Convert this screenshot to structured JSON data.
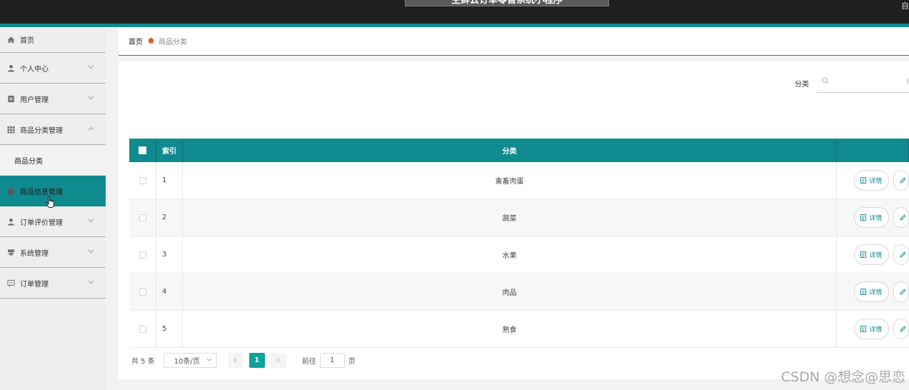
{
  "header": {
    "title": "生鲜云订单零售系统小程序",
    "corner_text": "自"
  },
  "sidebar": {
    "items": [
      {
        "label": "首页",
        "icon": "home-icon",
        "has_chevron": false
      },
      {
        "label": "个人中心",
        "icon": "user-icon",
        "has_chevron": true
      },
      {
        "label": "用户管理",
        "icon": "id-card-icon",
        "has_chevron": true
      },
      {
        "label": "商品分类管理",
        "icon": "grid-icon",
        "has_chevron": true,
        "expanded": true,
        "children": [
          {
            "label": "商品分类"
          }
        ]
      },
      {
        "label": "商品信息管理",
        "icon": "bag-icon",
        "has_chevron": false,
        "active": true
      },
      {
        "label": "订单评价管理",
        "icon": "user-icon",
        "has_chevron": true
      },
      {
        "label": "系统管理",
        "icon": "signpost-icon",
        "has_chevron": true
      },
      {
        "label": "订单管理",
        "icon": "message-icon",
        "has_chevron": true
      }
    ]
  },
  "breadcrumb": {
    "home": "首页",
    "current": "商品分类"
  },
  "search": {
    "label": "分类",
    "value": ""
  },
  "table": {
    "columns": [
      "索引",
      "分类",
      ""
    ],
    "rows": [
      {
        "index": "1",
        "category": "禽畜肉蛋"
      },
      {
        "index": "2",
        "category": "蔬菜"
      },
      {
        "index": "3",
        "category": "水果"
      },
      {
        "index": "4",
        "category": "肉品"
      },
      {
        "index": "5",
        "category": "熟食"
      }
    ],
    "detail_label": "详情"
  },
  "pagination": {
    "total": "共 5 条",
    "page_size": "10条/页",
    "current_page": "1",
    "goto_prefix": "前往",
    "goto_value": "1",
    "goto_suffix": "页"
  },
  "watermark": "CSDN @想念@思恋",
  "colors": {
    "primary": "#0f8a8f",
    "page_active": "#0fa39b",
    "breadcrumb_sep": "#e05a2a"
  }
}
